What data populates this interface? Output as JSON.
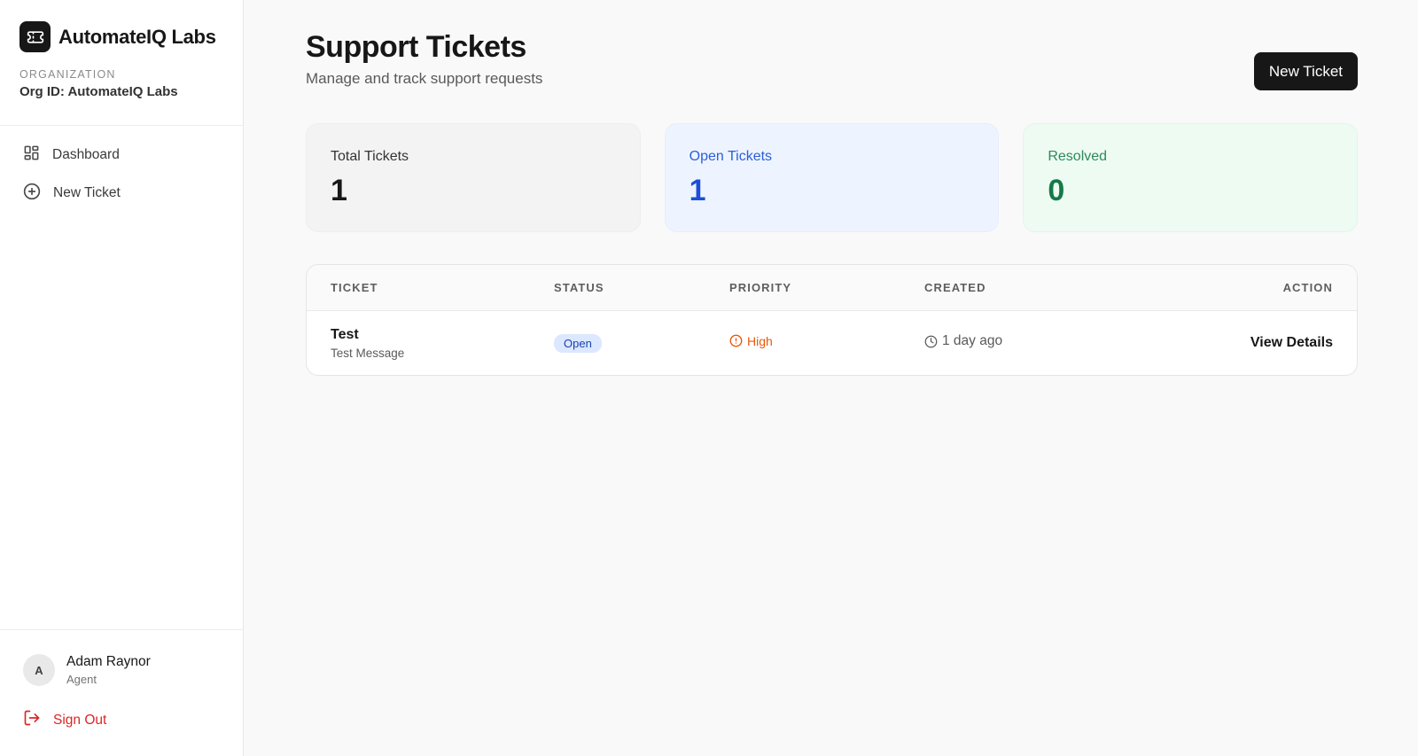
{
  "brand": {
    "name": "AutomateIQ Labs",
    "logo_icon": "ticket-icon"
  },
  "organization": {
    "label": "ORGANIZATION",
    "org_id": "Org ID: AutomateIQ Labs"
  },
  "nav": {
    "items": [
      {
        "label": "Dashboard",
        "icon": "dashboard-grid-icon"
      },
      {
        "label": "New Ticket",
        "icon": "plus-circle-icon"
      }
    ]
  },
  "user": {
    "avatar_initial": "A",
    "name": "Adam Raynor",
    "role": "Agent"
  },
  "signout": {
    "label": "Sign Out",
    "icon": "logout-icon",
    "color": "#dc2626"
  },
  "header": {
    "title": "Support Tickets",
    "subtitle": "Manage and track support requests",
    "new_ticket_label": "New Ticket"
  },
  "stats": {
    "total": {
      "label": "Total Tickets",
      "value": "1"
    },
    "open": {
      "label": "Open Tickets",
      "value": "1",
      "color": "#1d4ed8"
    },
    "resolved": {
      "label": "Resolved",
      "value": "0",
      "color": "#157a47"
    }
  },
  "table": {
    "columns": [
      "TICKET",
      "STATUS",
      "PRIORITY",
      "CREATED",
      "ACTION"
    ],
    "rows": [
      {
        "title": "Test",
        "message": "Test Message",
        "status": "Open",
        "priority": "High",
        "priority_icon": "alert-circle-icon",
        "created": "1 day ago",
        "created_icon": "clock-icon",
        "action": "View Details"
      }
    ]
  }
}
